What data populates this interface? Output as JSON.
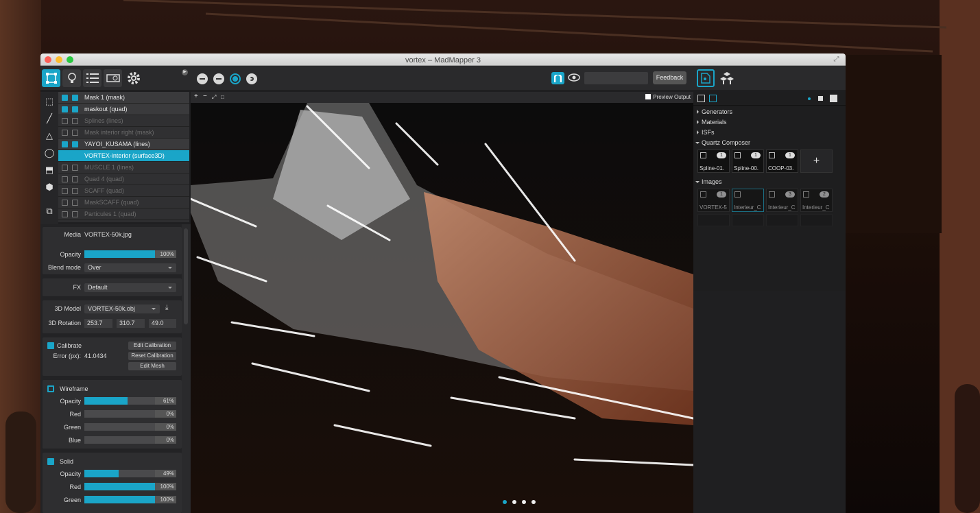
{
  "window": {
    "title": "vortex – MadMapper 3"
  },
  "toolbar": {
    "left_icons": [
      "surface-tool-icon",
      "lightbulb-icon",
      "list-icon",
      "projector-icon",
      "gear-icon"
    ],
    "transport_icons": [
      "menu-circle-icon",
      "minus-circle-icon",
      "minus-circle-active-icon",
      "refresh-circle-icon"
    ],
    "dropdown_value": "",
    "feedback_label": "Feedback"
  },
  "layers": [
    {
      "label": "Mask 1 (mask)",
      "state": "on"
    },
    {
      "label": "maskout (quad)",
      "state": "on"
    },
    {
      "label": "Splines (lines)",
      "state": "dim"
    },
    {
      "label": "Mask interior right (mask)",
      "state": "dim"
    },
    {
      "label": "YAYOI_KUSAMA (lines)",
      "state": "on"
    },
    {
      "label": "VORTEX-interior (surface3D)",
      "state": "sel"
    },
    {
      "label": "MUSCLE 1 (lines)",
      "state": "dim"
    },
    {
      "label": "Quad 4 (quad)",
      "state": "dim"
    },
    {
      "label": "SCAFF (quad)",
      "state": "dim"
    },
    {
      "label": "MaskSCAFF (quad)",
      "state": "dim"
    },
    {
      "label": "Particules 1 (quad)",
      "state": "dim"
    }
  ],
  "props": {
    "media_label": "Media",
    "media_value": "VORTEX-50k.jpg",
    "opacity_label": "Opacity",
    "opacity_value": "100%",
    "opacity_level": 1.0,
    "blend_label": "Blend mode",
    "blend_value": "Over",
    "fx_label": "FX",
    "fx_value": "Default",
    "model_label": "3D Model",
    "model_value": "VORTEX-50k.obj",
    "rotation_label": "3D Rotation",
    "rot_x": "253.7",
    "rot_y": "310.7",
    "rot_z": "49.0",
    "calibrate_label": "Calibrate",
    "error_label": "Error (px):",
    "error_value": "41.0434",
    "edit_calibration": "Edit Calibration",
    "reset_calibration": "Reset Calibration",
    "edit_mesh": "Edit Mesh",
    "wireframe_label": "Wireframe",
    "wireframe": [
      {
        "label": "Opacity",
        "value": "61%",
        "level": 0.61
      },
      {
        "label": "Red",
        "value": "0%",
        "level": 0
      },
      {
        "label": "Green",
        "value": "0%",
        "level": 0
      },
      {
        "label": "Blue",
        "value": "0%",
        "level": 0
      }
    ],
    "solid_label": "Solid",
    "solid": [
      {
        "label": "Opacity",
        "value": "49%",
        "level": 0.49
      },
      {
        "label": "Red",
        "value": "100%",
        "level": 1
      },
      {
        "label": "Green",
        "value": "100%",
        "level": 1
      }
    ]
  },
  "viewbar": {
    "icons": [
      "+",
      "−",
      "⤢",
      "□"
    ],
    "preview_label": "Preview Output"
  },
  "library": {
    "tree": [
      "Generators",
      "Materials",
      "ISFs",
      "Quartz Composer"
    ],
    "qc_items": [
      {
        "label": "Spline-01.",
        "num": "1"
      },
      {
        "label": "Spline-00.",
        "num": "1"
      },
      {
        "label": "COOP-03.",
        "num": "1"
      }
    ],
    "images_label": "Images",
    "image_items": [
      {
        "label": "VORTEX-5",
        "num": "1"
      },
      {
        "label": "Interieur_C",
        "num": ""
      },
      {
        "label": "Interieur_C",
        "num": "3"
      },
      {
        "label": "Interieur_C",
        "num": "2"
      }
    ],
    "plus": "+"
  },
  "colors": {
    "accent": "#1aa5c8"
  }
}
